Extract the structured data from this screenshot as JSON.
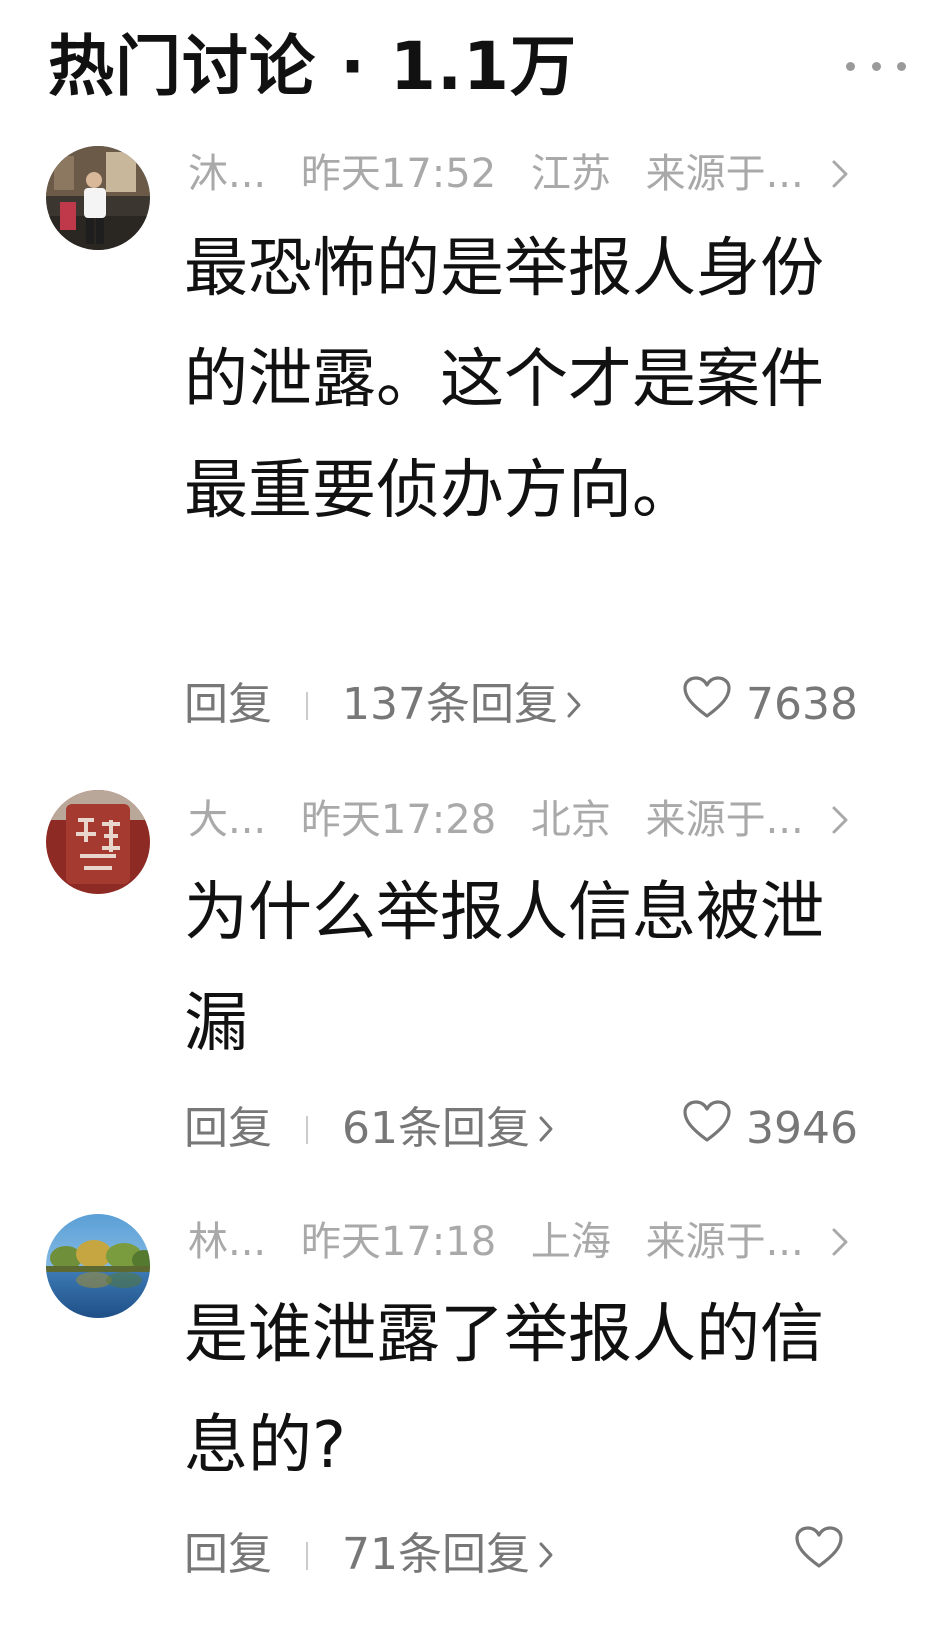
{
  "header": {
    "title": "热门讨论 · 1.1万"
  },
  "comments": [
    {
      "username": "沐...",
      "time": "昨天17:52",
      "location": "江苏",
      "source": "来源于...",
      "text": "最恐怖的是举报人身份的泄露。这个才是案件最重要侦办方向。",
      "reply_label": "回复",
      "replies_label": "137条回复",
      "likes": "7638"
    },
    {
      "username": "大...",
      "time": "昨天17:28",
      "location": "北京",
      "source": "来源于...",
      "text": "为什么举报人信息被泄漏",
      "reply_label": "回复",
      "replies_label": "61条回复",
      "likes": "3946"
    },
    {
      "username": "林...",
      "time": "昨天17:18",
      "location": "上海",
      "source": "来源于...",
      "text": "是谁泄露了举报人的信息的?",
      "reply_label": "回复",
      "replies_label": "71条回复",
      "likes": ""
    }
  ],
  "icons": {
    "more": "more-dots-icon",
    "chevron": "chevron-right-icon",
    "like": "heart-outline-icon"
  },
  "colors": {
    "text": "#111111",
    "meta": "#a9a9a9",
    "action": "#777777"
  }
}
